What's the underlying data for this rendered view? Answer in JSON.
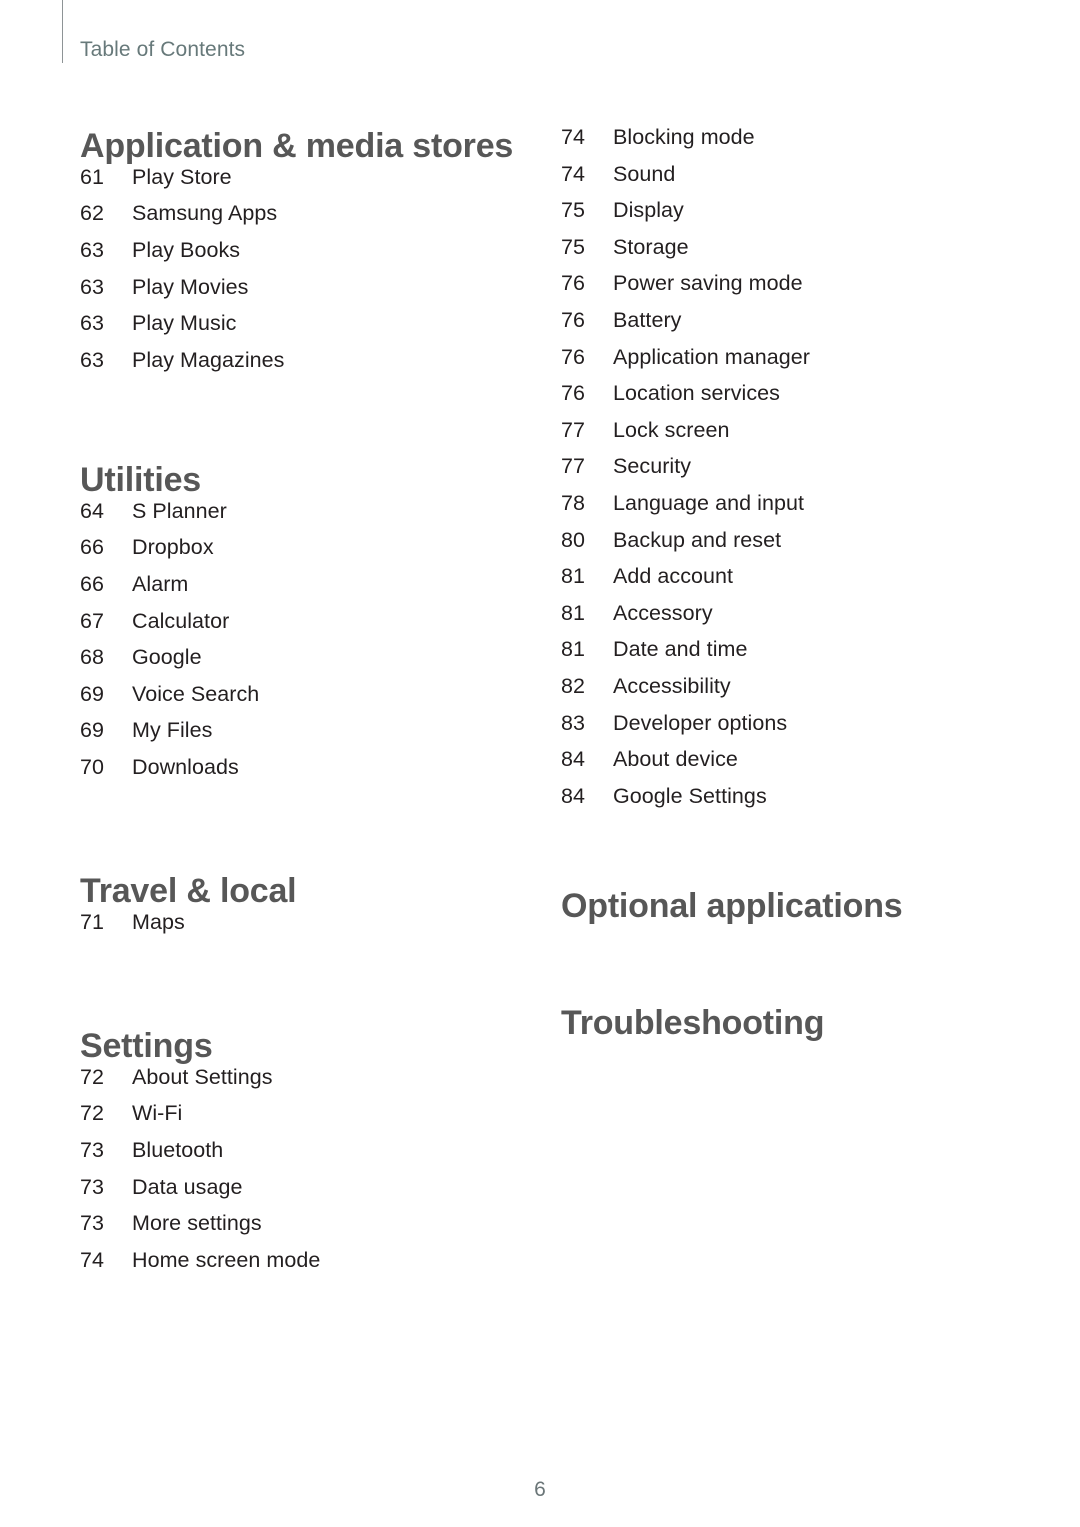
{
  "header": {
    "title": "Table of Contents"
  },
  "footer": {
    "page_number": "6"
  },
  "colors": {
    "heading": "#575757",
    "body": "#231f20",
    "header_accent": "#67797a",
    "rule": "#8e9496",
    "background": "#ffffff"
  },
  "columns": {
    "left": [
      {
        "heading": "Application & media stores",
        "entries": [
          {
            "page": "61",
            "label": "Play Store"
          },
          {
            "page": "62",
            "label": "Samsung Apps"
          },
          {
            "page": "63",
            "label": "Play Books"
          },
          {
            "page": "63",
            "label": "Play Movies"
          },
          {
            "page": "63",
            "label": "Play Music"
          },
          {
            "page": "63",
            "label": "Play Magazines"
          }
        ]
      },
      {
        "heading": "Utilities",
        "entries": [
          {
            "page": "64",
            "label": "S Planner"
          },
          {
            "page": "66",
            "label": "Dropbox"
          },
          {
            "page": "66",
            "label": "Alarm"
          },
          {
            "page": "67",
            "label": "Calculator"
          },
          {
            "page": "68",
            "label": "Google"
          },
          {
            "page": "69",
            "label": "Voice Search"
          },
          {
            "page": "69",
            "label": "My Files"
          },
          {
            "page": "70",
            "label": "Downloads"
          }
        ]
      },
      {
        "heading": "Travel & local",
        "entries": [
          {
            "page": "71",
            "label": "Maps"
          }
        ]
      },
      {
        "heading": "Settings",
        "entries": [
          {
            "page": "72",
            "label": "About Settings"
          },
          {
            "page": "72",
            "label": "Wi-Fi"
          },
          {
            "page": "73",
            "label": "Bluetooth"
          },
          {
            "page": "73",
            "label": "Data usage"
          },
          {
            "page": "73",
            "label": "More settings"
          },
          {
            "page": "74",
            "label": "Home screen mode"
          }
        ]
      }
    ],
    "right": [
      {
        "heading": "",
        "entries": [
          {
            "page": "74",
            "label": "Blocking mode"
          },
          {
            "page": "74",
            "label": "Sound"
          },
          {
            "page": "75",
            "label": "Display"
          },
          {
            "page": "75",
            "label": "Storage"
          },
          {
            "page": "76",
            "label": "Power saving mode"
          },
          {
            "page": "76",
            "label": "Battery"
          },
          {
            "page": "76",
            "label": "Application manager"
          },
          {
            "page": "76",
            "label": "Location services"
          },
          {
            "page": "77",
            "label": "Lock screen"
          },
          {
            "page": "77",
            "label": "Security"
          },
          {
            "page": "78",
            "label": "Language and input"
          },
          {
            "page": "80",
            "label": "Backup and reset"
          },
          {
            "page": "81",
            "label": "Add account"
          },
          {
            "page": "81",
            "label": "Accessory"
          },
          {
            "page": "81",
            "label": "Date and time"
          },
          {
            "page": "82",
            "label": "Accessibility"
          },
          {
            "page": "83",
            "label": "Developer options"
          },
          {
            "page": "84",
            "label": "About device"
          },
          {
            "page": "84",
            "label": "Google Settings"
          }
        ]
      },
      {
        "heading": "Optional applications",
        "entries": []
      },
      {
        "heading": "Troubleshooting",
        "entries": []
      }
    ]
  },
  "layout": {
    "left_section_tops": [
      128,
      462,
      873,
      1028
    ],
    "right_section_tops": [
      125,
      888,
      1005
    ]
  }
}
